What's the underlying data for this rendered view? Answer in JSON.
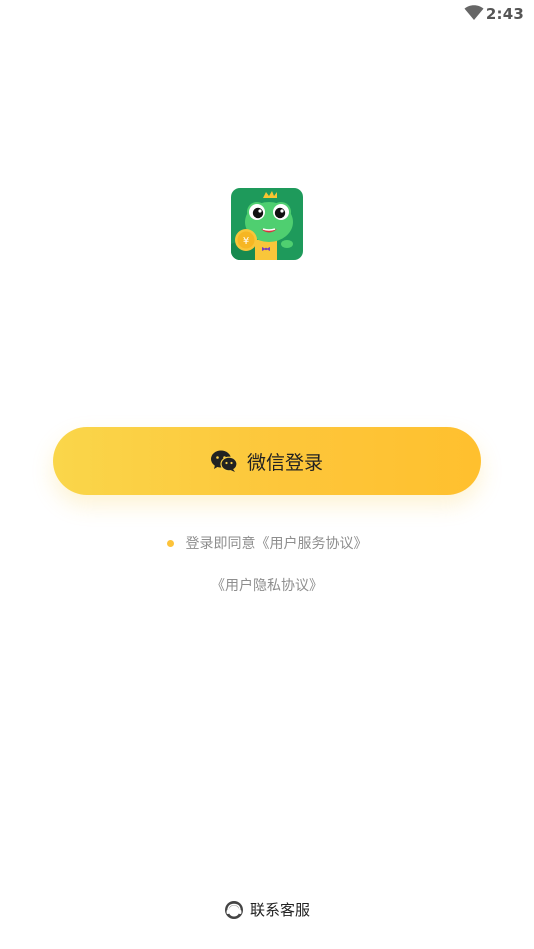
{
  "status_bar": {
    "time": "2:43",
    "wifi_icon": "wifi-icon"
  },
  "app_logo": {
    "icon": "frog-mascot-logo",
    "bg_color": "#1e9a5b"
  },
  "login": {
    "button_label": "微信登录",
    "icon": "wechat-icon",
    "gradient": [
      "#fad64a",
      "#ffc02e"
    ]
  },
  "agreement": {
    "prefix": "登录即同意",
    "service_link": "《用户服务协议》",
    "privacy_link": "《用户隐私协议》",
    "dot_color": "#fdc33a"
  },
  "footer": {
    "contact_label": "联系客服",
    "icon": "headset-icon"
  }
}
